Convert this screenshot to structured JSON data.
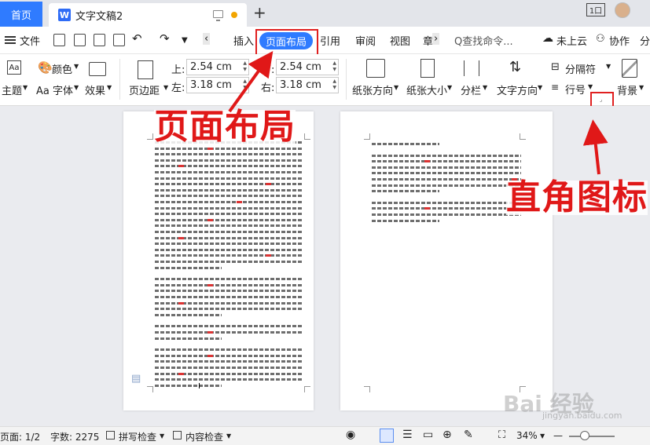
{
  "tabs": {
    "home": "首页",
    "doc_icon": "W",
    "doc_title": "文字文稿2",
    "plus": "+",
    "badge_icon": "1口"
  },
  "menu": {
    "file": "文件",
    "chevron_left": "‹",
    "insert": "插入",
    "page_layout": "页面布局",
    "references": "引用",
    "review": "审阅",
    "view": "视图",
    "chevron_right": "›",
    "search_placeholder": "Q查找命令...",
    "cloud": "未上云",
    "collab": "协作",
    "share": "分"
  },
  "ribbon": {
    "theme": "主题",
    "color": "颜色",
    "font": "Aa 字体",
    "effects": "效果",
    "margins": "页边距",
    "top_label": "上:",
    "top_value": "2.54 cm",
    "bottom_label": "下:",
    "bottom_value": "2.54 cm",
    "left_label": "左:",
    "left_value": "3.18 cm",
    "right_label": "右:",
    "right_value": "3.18 cm",
    "orientation": "纸张方向",
    "size": "纸张大小",
    "columns": "分栏",
    "text_direction": "文字方向",
    "separator": "分隔符",
    "line_number": "行号",
    "background": "背景"
  },
  "annotations": {
    "page_layout_label": "页面布局",
    "corner_icon_label": "直角图标"
  },
  "status": {
    "page": "页面: 1/2",
    "word_count": "字数: 2275",
    "spell_check": "拼写检查",
    "content_check": "内容检查",
    "zoom": "34%",
    "zoom_minus": "—",
    "watermark": "Bai 经验",
    "watermark_sub": "jingyan.baidu.com"
  },
  "colors": {
    "accent": "#2f7bff",
    "annotation_red": "#e01818"
  }
}
